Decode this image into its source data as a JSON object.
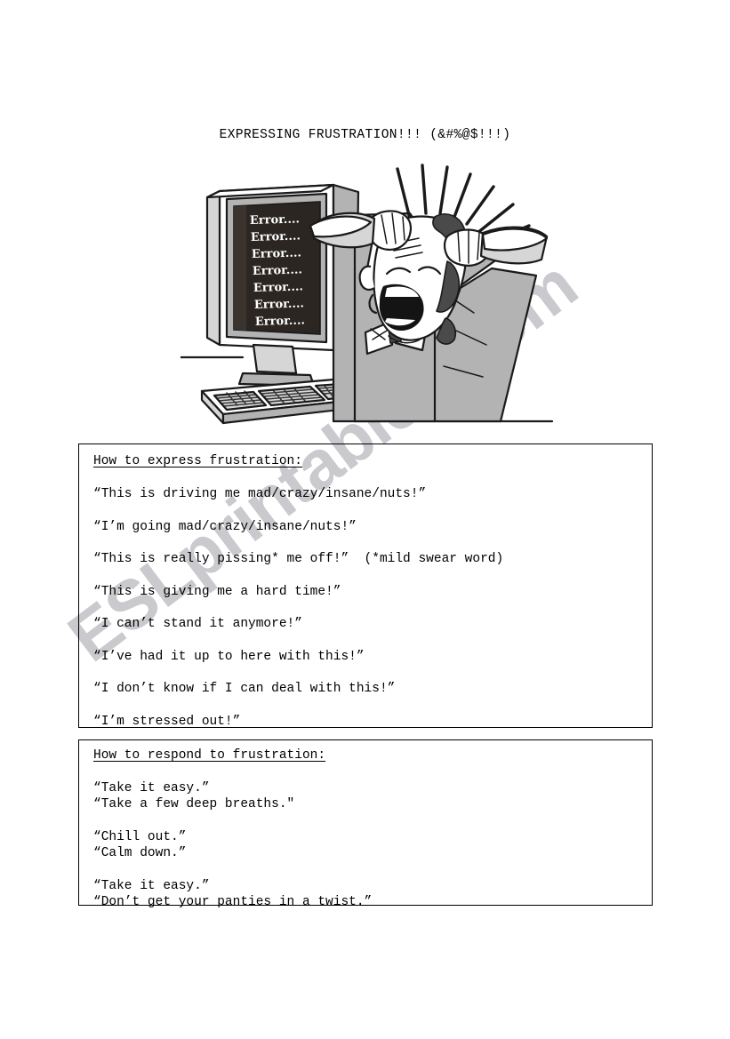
{
  "document": {
    "title": "EXPRESSING FRUSTRATION!!! (&#%@$!!!)",
    "watermark": "ESLprintables.com",
    "watermark_color": "#c9c9ce"
  },
  "illustration": {
    "name": "frustrated-man-at-computer",
    "screen_lines": [
      "Error....",
      "Error....",
      "Error....",
      "Error....",
      "Error....",
      "Error....",
      "Error...."
    ],
    "screen_color": "#2b2622",
    "screen_text_color": "#ffffff"
  },
  "express_box": {
    "heading": "How to express frustration:",
    "phrases": [
      "“This is driving me mad/crazy/insane/nuts!”",
      "“I’m going mad/crazy/insane/nuts!”",
      "“This is really pissing* me off!”  (*mild swear word)",
      "“This is giving me a hard time!”",
      "“I can’t stand it anymore!”",
      "“I’ve had it up to here with this!”",
      "“I don’t know if I can deal with this!”",
      "“I’m stressed out!”"
    ]
  },
  "respond_box": {
    "heading": "How to respond to frustration:",
    "groups": [
      [
        "“Take it easy.”",
        "“Take a few deep breaths.\""
      ],
      [
        "“Chill out.”",
        "“Calm down.”"
      ],
      [
        "“Take it easy.”",
        "“Don’t get your panties in a twist.”"
      ]
    ]
  }
}
